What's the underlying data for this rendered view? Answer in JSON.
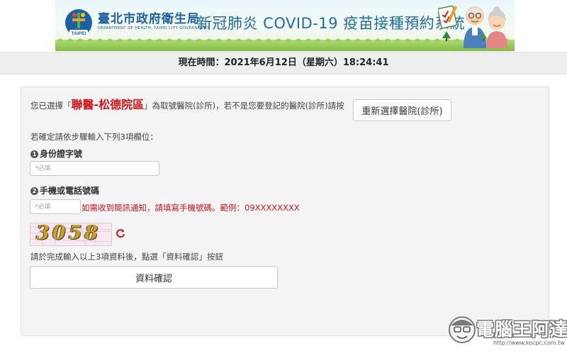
{
  "header": {
    "agency_name": "臺北市政府衛生局",
    "agency_english": "DEPARTMENT OF HEALTH, TAIPEI CITY GOVERNMENT",
    "logo_text": "TAIPEI",
    "system_title": "新冠肺炎 COVID-19 疫苗接種預約系統"
  },
  "time_bar": {
    "text": "現在時間：2021年6月12日（星期六）18:24:41"
  },
  "form": {
    "selected_prefix": "您已選擇「",
    "hospital_name": "聯醫-松德院區",
    "selected_suffix": "」為取號醫院(診所)，若不是您要登記的醫院(診所)請按",
    "reselect_button": "重新選擇醫院(診所)",
    "instruction": "若確定請依步驟輸入下列3項欄位：",
    "step1": {
      "number": "1",
      "label": "身份證字號",
      "placeholder": "*必填"
    },
    "step2": {
      "number": "2",
      "label": "手機或電話號碼",
      "placeholder": "*必填",
      "hint": "如需收到簡訊通知，請填寫手機號碼。範例：09XXXXXXXX"
    },
    "captcha": {
      "code": "3058"
    },
    "confirm_instruction": "請於完成輸入以上3項資料後，點選「資料確認」按鈕",
    "confirm_button": "資料確認"
  },
  "watermark": {
    "text": "電腦王阿達",
    "url": "http://www.kocpc.com.tw"
  },
  "colors": {
    "accent_red": "#d4161c",
    "title_blue": "#1e6ca8",
    "panel_bg": "#f4f4f4"
  },
  "icons": [
    "taipei-health-logo-icon",
    "clipboard-icon",
    "elderly-couple-icon",
    "refresh-icon",
    "mascot-face-icon"
  ]
}
